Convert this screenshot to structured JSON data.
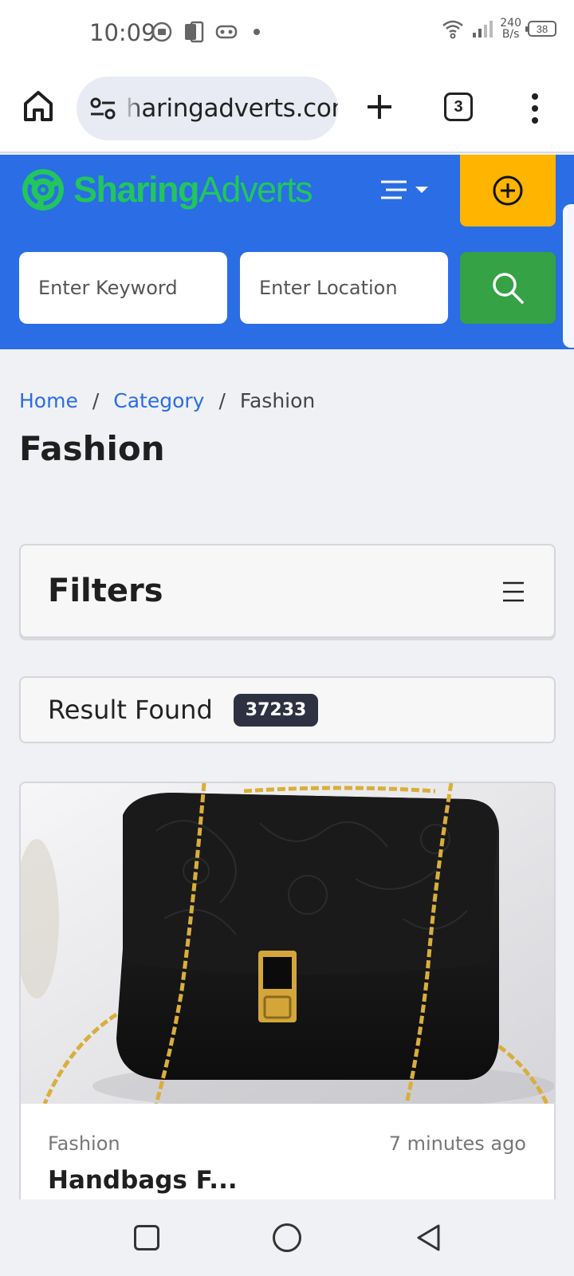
{
  "status_bar": {
    "time": "10:09",
    "net_speed_value": "240",
    "net_speed_unit": "B/s",
    "battery": "38"
  },
  "browser": {
    "url": "haringadverts.com",
    "tab_count": "3"
  },
  "site": {
    "logo_part1": "Sharing",
    "logo_part2": "Adverts",
    "brand_color": "#2a6de4",
    "logo_color": "#22c55e",
    "post_ad_color": "#ffb400",
    "search_color": "#34a245"
  },
  "search": {
    "keyword_placeholder": "Enter Keyword",
    "location_placeholder": "Enter Location"
  },
  "breadcrumb": {
    "home": "Home",
    "category": "Category",
    "current": "Fashion",
    "separator": "/"
  },
  "page": {
    "title": "Fashion"
  },
  "filters": {
    "title": "Filters"
  },
  "results": {
    "label": "Result Found",
    "count": "37233"
  },
  "listing": {
    "category": "Fashion",
    "time_ago": "7 minutes ago",
    "title": "Handbags F..."
  }
}
